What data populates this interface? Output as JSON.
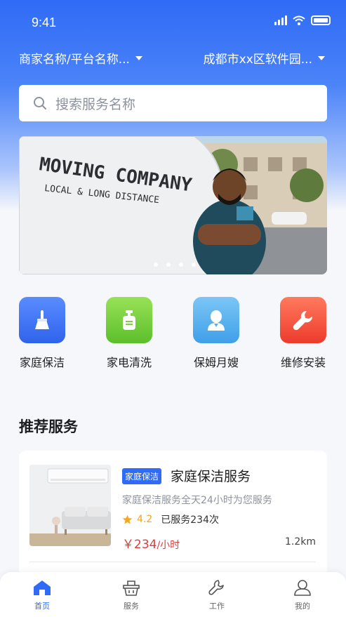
{
  "status_bar": {
    "time": "9:41"
  },
  "header": {
    "merchant_label": "商家名称/平台名称...",
    "city_label": "成都市xx区软件园..."
  },
  "search": {
    "placeholder": "搜索服务名称"
  },
  "banner": {
    "text_line1": "MOVING COMPANY",
    "text_line2": "LOCAL & LONG DISTANCE",
    "dot_count": 4
  },
  "categories": [
    {
      "label": "家庭保洁",
      "icon": "broom-icon",
      "color": "#3e74f4"
    },
    {
      "label": "家电清洗",
      "icon": "soap-bottle-icon",
      "color": "#7ed03e"
    },
    {
      "label": "保姆月嫂",
      "icon": "nanny-icon",
      "color": "#57b3f0"
    },
    {
      "label": "维修安装",
      "icon": "wrench-icon",
      "color": "#f2533f"
    }
  ],
  "recommend": {
    "title": "推荐服务",
    "items": [
      {
        "tag": "家庭保洁",
        "title": "家庭保洁服务",
        "desc": "家庭保洁服务全天24小时为您服务",
        "rating": "4.2",
        "served": "已服务234次",
        "price": "￥234",
        "unit": "/小时",
        "distance": "1.2km"
      }
    ]
  },
  "tabbar": {
    "items": [
      {
        "label": "首页",
        "icon": "home-icon",
        "active": true
      },
      {
        "label": "服务",
        "icon": "basket-icon",
        "active": false
      },
      {
        "label": "工作",
        "icon": "tool-icon",
        "active": false
      },
      {
        "label": "我的",
        "icon": "profile-icon",
        "active": false
      }
    ]
  },
  "colors": {
    "primary": "#2f6bf6",
    "price": "#e23a3a",
    "star": "#f5a623"
  }
}
